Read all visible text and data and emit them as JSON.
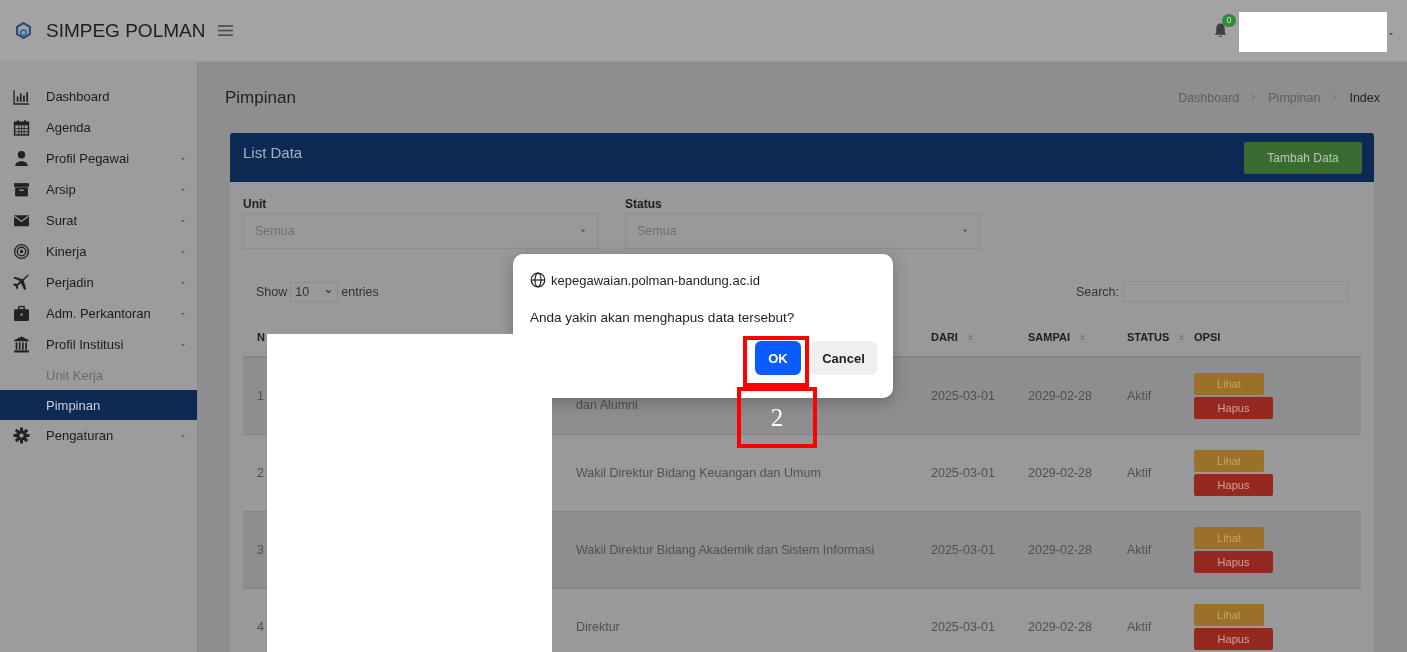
{
  "app": {
    "title": "SIMPEG POLMAN",
    "notification_count": "0"
  },
  "sidebar": {
    "items": [
      {
        "label": "Dashboard",
        "kind": "link",
        "selected": false
      },
      {
        "label": "Agenda",
        "kind": "link",
        "selected": false
      },
      {
        "label": "Profil Pegawai",
        "kind": "dropdown",
        "selected": false
      },
      {
        "label": "Arsip",
        "kind": "dropdown",
        "selected": false
      },
      {
        "label": "Surat",
        "kind": "dropdown",
        "selected": false
      },
      {
        "label": "Kinerja",
        "kind": "dropdown",
        "selected": false
      },
      {
        "label": "Perjadin",
        "kind": "dropdown",
        "selected": false
      },
      {
        "label": "Adm. Perkantoran",
        "kind": "dropdown",
        "selected": false
      },
      {
        "label": "Profil Institusi",
        "kind": "dropdown",
        "selected": false,
        "children": [
          {
            "label": "Unit Kerja",
            "selected": false
          },
          {
            "label": "Pimpinan",
            "selected": true
          }
        ]
      },
      {
        "label": "Pengaturan",
        "kind": "dropdown",
        "selected": false
      }
    ]
  },
  "page": {
    "title": "Pimpinan",
    "breadcrumb": [
      {
        "label": "Dashboard",
        "current": false
      },
      {
        "label": "Pimpinan",
        "current": false
      },
      {
        "label": "Index",
        "current": true
      }
    ]
  },
  "card": {
    "title": "List Data",
    "add_button": "Tambah Data",
    "filters": [
      {
        "label": "Unit",
        "value": "Semua"
      },
      {
        "label": "Status",
        "value": "Semua"
      }
    ],
    "length": {
      "prefix": "Show",
      "value": "10",
      "suffix": "entries"
    },
    "search": {
      "label": "Search:"
    },
    "table": {
      "columns": [
        {
          "label": "N",
          "sortable": false
        },
        {
          "label": "DARI",
          "sortable": true
        },
        {
          "label": "SAMPAI",
          "sortable": true
        },
        {
          "label": "STATUS",
          "sortable": true
        },
        {
          "label": "OPSI",
          "sortable": false
        }
      ],
      "rows": [
        {
          "no": "1",
          "jabatan": "dan Alumni",
          "dari": "2025-03-01",
          "sampai": "2029-02-28",
          "status": "Aktif",
          "actions": [
            "Lihat",
            "Hapus"
          ]
        },
        {
          "no": "2",
          "jabatan": "Wakil Direktur Bidang Keuangan dan Umum",
          "dari": "2025-03-01",
          "sampai": "2029-02-28",
          "status": "Aktif",
          "actions": [
            "Lihat",
            "Hapus"
          ]
        },
        {
          "no": "3",
          "jabatan": "Wakil Direktur Bidang Akademik dan Sistem Informasi",
          "dari": "2025-03-01",
          "sampai": "2029-02-28",
          "status": "Aktif",
          "actions": [
            "Lihat",
            "Hapus"
          ]
        },
        {
          "no": "4",
          "jabatan": "Direktur",
          "dari": "2025-03-01",
          "sampai": "2029-02-28",
          "status": "Aktif",
          "actions": [
            "Lihat",
            "Hapus"
          ]
        }
      ]
    }
  },
  "dialog": {
    "origin": "kepegawaian.polman-bandung.ac.id",
    "message": "Anda yakin akan menghapus data tersebut?",
    "buttons": [
      {
        "label": "OK",
        "kind": "primary"
      },
      {
        "label": "Cancel",
        "kind": "secondary"
      }
    ]
  },
  "annotation": {
    "label": "2"
  }
}
